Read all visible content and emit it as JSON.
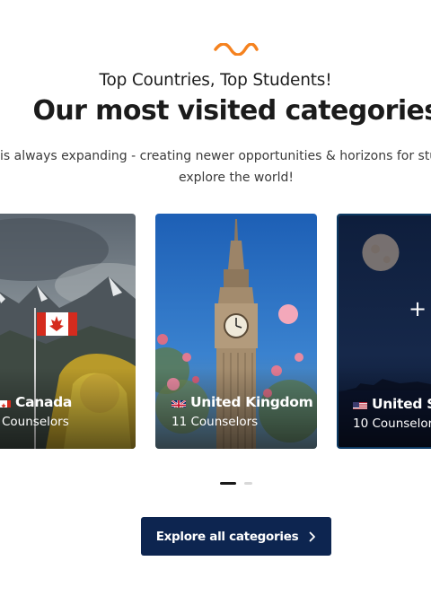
{
  "header": {
    "eyebrow": "Top Countries, Top Students!",
    "title": "Our most visited categories",
    "description_line1": "is always expanding - creating newer opportunities & horizons for stude",
    "description_line2": "explore the world!"
  },
  "cards": [
    {
      "country": "Canada",
      "count": "Counselors",
      "flag": "flag-canada-icon"
    },
    {
      "country": "United Kingdom",
      "count": "11 Counselors",
      "flag": "flag-uk-icon"
    },
    {
      "country": "United St",
      "count": "10 Counselors",
      "flag": "flag-us-icon",
      "action": "+"
    }
  ],
  "carousel": {
    "active_index": 0,
    "pages": 2
  },
  "cta": {
    "label": "Explore all categories",
    "icon": "chevron-right-icon"
  },
  "colors": {
    "accent": "#f5821f",
    "button_bg": "#0d2550",
    "heading": "#1b1b1b",
    "active_card_border": "#0c3a63"
  }
}
